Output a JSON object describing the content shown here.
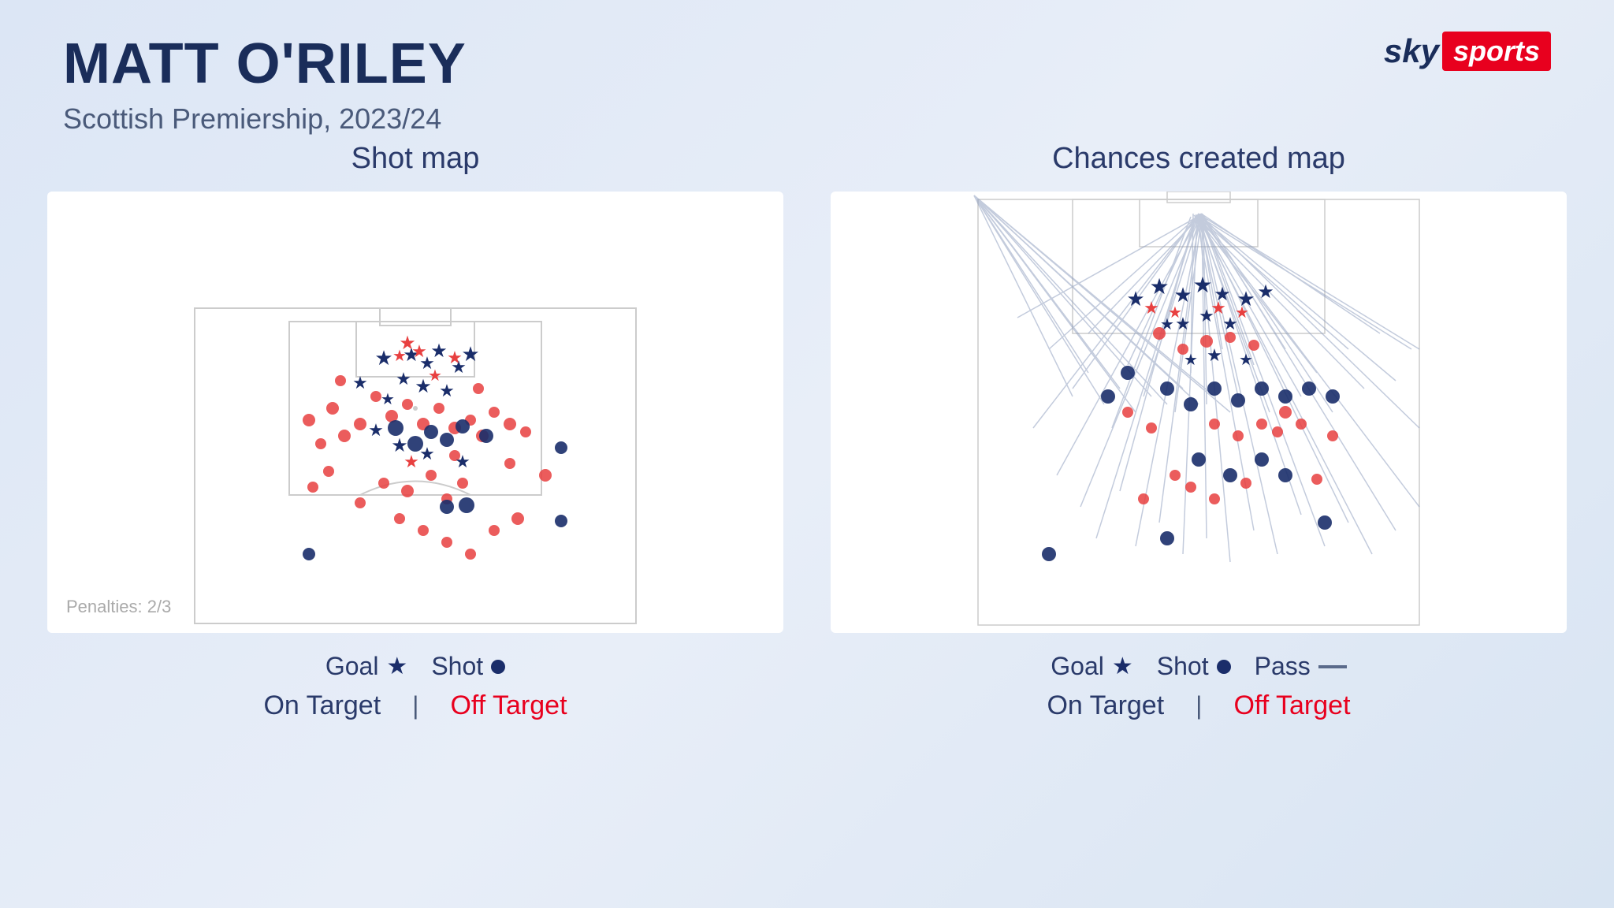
{
  "header": {
    "player_name": "MATT O'RILEY",
    "subtitle": "Scottish Premiership, 2023/24"
  },
  "logo": {
    "sky": "sky",
    "sports": "sports"
  },
  "shot_map": {
    "title": "Shot map",
    "penalties_note": "Penalties: 2/3",
    "legend": {
      "goal_label": "Goal",
      "shot_label": "Shot",
      "on_target": "On Target",
      "separator": "|",
      "off_target": "Off Target"
    }
  },
  "chances_map": {
    "title": "Chances created map",
    "legend": {
      "goal_label": "Goal",
      "shot_label": "Shot",
      "pass_label": "Pass",
      "on_target": "On Target",
      "separator": "|",
      "off_target": "Off Target"
    }
  }
}
